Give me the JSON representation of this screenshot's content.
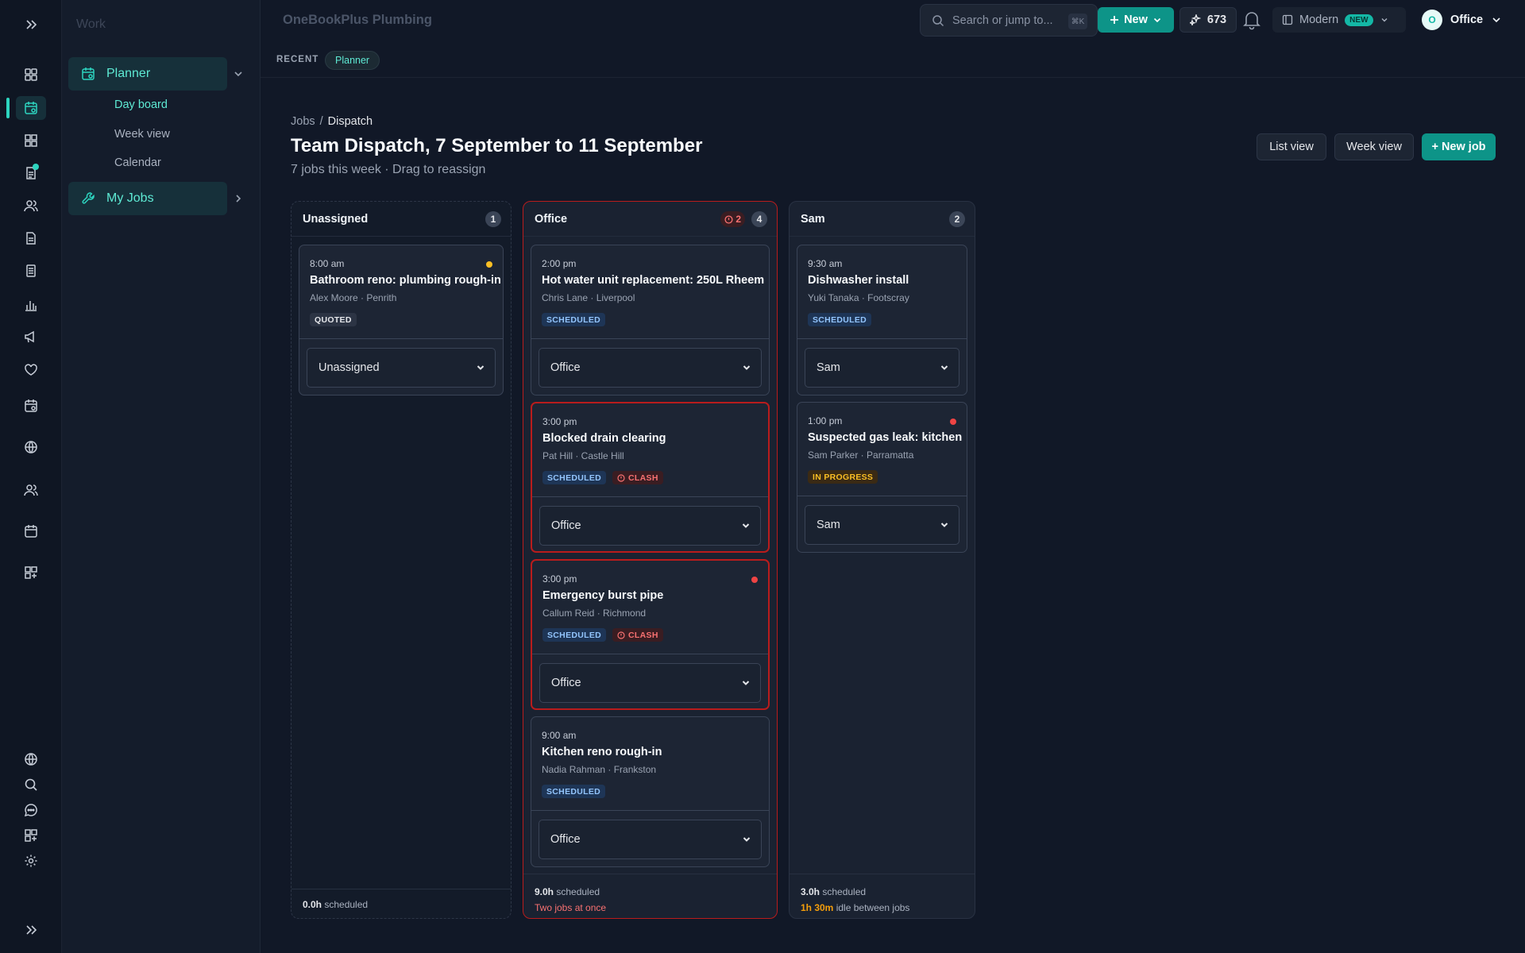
{
  "app": {
    "brand": "OneBookPlus Plumbing",
    "accent": "#14b8a6"
  },
  "rail": {
    "top_icons": [
      "expand-icon",
      "dashboard-icon",
      "planner-icon",
      "apps-icon",
      "documents-icon",
      "customers-icon",
      "invoices-icon",
      "quotes-icon",
      "reports-icon",
      "marketing-icon",
      "favorites-icon",
      "calendar-icon",
      "web-icon",
      "team-icon",
      "schedule-icon",
      "add-app-icon"
    ],
    "bottom_icons": [
      "globe-icon",
      "search-icon",
      "chat-icon",
      "add-app-icon",
      "settings-icon",
      "expand-icon"
    ]
  },
  "subnav": {
    "title": "Work",
    "groups": [
      {
        "label": "Planner",
        "icon": "calendar-icon",
        "items": [
          "Day board",
          "Week view",
          "Calendar"
        ]
      },
      {
        "label": "My Jobs",
        "icon": "wrench-icon",
        "items": []
      }
    ]
  },
  "topbar": {
    "search_placeholder": "Search or jump to...",
    "search_shortcut": "⌘K",
    "new_label": "New",
    "credits": "673",
    "mode_label": "Modern",
    "mode_badge": "NEW",
    "user_initial": "O",
    "user_name": "Office"
  },
  "recent": {
    "label": "RECENT",
    "chip": "Planner"
  },
  "header": {
    "breadcrumb": [
      "Jobs",
      "Dispatch"
    ],
    "title": "Team Dispatch, 7 September to 11 September",
    "subtitle": "7 jobs this week · Drag to reassign",
    "buttons": {
      "list_view": "List view",
      "week_view": "Week view",
      "new_job": "+ New job"
    }
  },
  "columns": [
    {
      "name": "Unassigned",
      "count": "1",
      "footer": {
        "hours": "0.0h",
        "hours_suffix": "scheduled"
      },
      "cards": [
        {
          "time": "8:00 am",
          "title": "Bathroom reno: plumbing rough-in",
          "meta": "Alex Moore · Penrith",
          "status": "QUOTED",
          "assignee": "Unassigned",
          "dot": "amber"
        }
      ]
    },
    {
      "name": "Office",
      "count": "4",
      "clash_count": "2",
      "footer": {
        "hours": "9.0h",
        "hours_suffix": "scheduled",
        "warning": "Two jobs at once"
      },
      "cards": [
        {
          "time": "2:00 pm",
          "title": "Hot water unit replacement: 250L Rheem",
          "meta": "Chris Lane · Liverpool",
          "status": "SCHEDULED",
          "assignee": "Office"
        },
        {
          "time": "3:00 pm",
          "title": "Blocked drain clearing",
          "meta": "Pat Hill · Castle Hill",
          "status": "SCHEDULED",
          "clash": "CLASH",
          "assignee": "Office"
        },
        {
          "time": "3:00 pm",
          "title": "Emergency burst pipe",
          "meta": "Callum Reid · Richmond",
          "status": "SCHEDULED",
          "clash": "CLASH",
          "assignee": "Office",
          "dot": "red"
        },
        {
          "time": "9:00 am",
          "title": "Kitchen reno rough-in",
          "meta": "Nadia Rahman · Frankston",
          "status": "SCHEDULED",
          "assignee": "Office"
        }
      ]
    },
    {
      "name": "Sam",
      "count": "2",
      "footer": {
        "hours": "3.0h",
        "hours_suffix": "scheduled",
        "idle": "1h 30m",
        "idle_suffix": "idle between jobs"
      },
      "cards": [
        {
          "time": "9:30 am",
          "title": "Dishwasher install",
          "meta": "Yuki Tanaka · Footscray",
          "status": "SCHEDULED",
          "assignee": "Sam"
        },
        {
          "time": "1:00 pm",
          "title": "Suspected gas leak: kitchen",
          "meta": "Sam Parker · Parramatta",
          "status": "IN PROGRESS",
          "assignee": "Sam",
          "dot": "red"
        }
      ]
    }
  ]
}
